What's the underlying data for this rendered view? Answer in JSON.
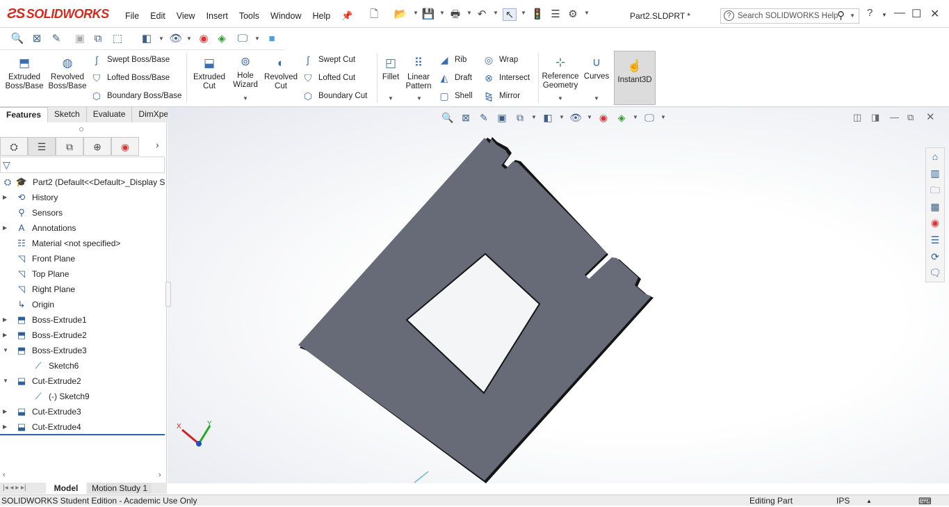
{
  "app": {
    "brand": "SOLIDWORKS",
    "doc_title": "Part2.SLDPRT *"
  },
  "menus": [
    "File",
    "Edit",
    "View",
    "Insert",
    "Tools",
    "Window",
    "Help"
  ],
  "search": {
    "placeholder": "Search SOLIDWORKS Help"
  },
  "features_toolbar": {
    "extruded_boss": "Extruded Boss/Base",
    "revolved_boss": "Revolved Boss/Base",
    "swept_boss": "Swept Boss/Base",
    "lofted_boss": "Lofted Boss/Base",
    "boundary_boss": "Boundary Boss/Base",
    "extruded_cut": "Extruded Cut",
    "hole_wizard": "Hole Wizard",
    "revolved_cut": "Revolved Cut",
    "swept_cut": "Swept Cut",
    "lofted_cut": "Lofted Cut",
    "boundary_cut": "Boundary Cut",
    "fillet": "Fillet",
    "linear_pattern": "Linear Pattern",
    "rib": "Rib",
    "draft": "Draft",
    "shell": "Shell",
    "wrap": "Wrap",
    "intersect": "Intersect",
    "mirror": "Mirror",
    "reference_geometry": "Reference Geometry",
    "curves": "Curves",
    "instant3d": "Instant3D"
  },
  "command_tabs": [
    "Features",
    "Sketch",
    "Evaluate",
    "DimXpert"
  ],
  "tree": {
    "root": "Part2  (Default<<Default>_Display S",
    "items": [
      {
        "label": "History",
        "icon": "history-icon",
        "expandable": true
      },
      {
        "label": "Sensors",
        "icon": "sensor-icon",
        "expandable": false
      },
      {
        "label": "Annotations",
        "icon": "annotation-icon",
        "expandable": true
      },
      {
        "label": "Material <not specified>",
        "icon": "material-icon",
        "expandable": false
      },
      {
        "label": "Front Plane",
        "icon": "plane-icon",
        "expandable": false
      },
      {
        "label": "Top Plane",
        "icon": "plane-icon",
        "expandable": false
      },
      {
        "label": "Right Plane",
        "icon": "plane-icon",
        "expandable": false
      },
      {
        "label": "Origin",
        "icon": "origin-icon",
        "expandable": false
      },
      {
        "label": "Boss-Extrude1",
        "icon": "extrude-icon",
        "expandable": true
      },
      {
        "label": "Boss-Extrude2",
        "icon": "extrude-icon",
        "expandable": true
      },
      {
        "label": "Boss-Extrude3",
        "icon": "extrude-icon",
        "expandable": true,
        "expanded": true
      },
      {
        "label": "Sketch6",
        "icon": "sketch-icon",
        "expandable": false,
        "child": true
      },
      {
        "label": "Cut-Extrude2",
        "icon": "cut-icon",
        "expandable": true,
        "expanded": true
      },
      {
        "label": "(-) Sketch9",
        "icon": "sketch-icon",
        "expandable": false,
        "child": true
      },
      {
        "label": "Cut-Extrude3",
        "icon": "cut-icon",
        "expandable": true
      },
      {
        "label": "Cut-Extrude4",
        "icon": "cut-icon",
        "expandable": true
      }
    ]
  },
  "bottom_tabs": [
    "Model",
    "Motion Study 1"
  ],
  "status": {
    "left": "SOLIDWORKS Student Edition - Academic Use Only",
    "mode": "Editing Part",
    "units": "IPS"
  },
  "triad": {
    "x": "X",
    "y": "Y"
  },
  "colors": {
    "accent": "#d52b1e",
    "part": "#676b78",
    "selection": "#2c62b0"
  }
}
